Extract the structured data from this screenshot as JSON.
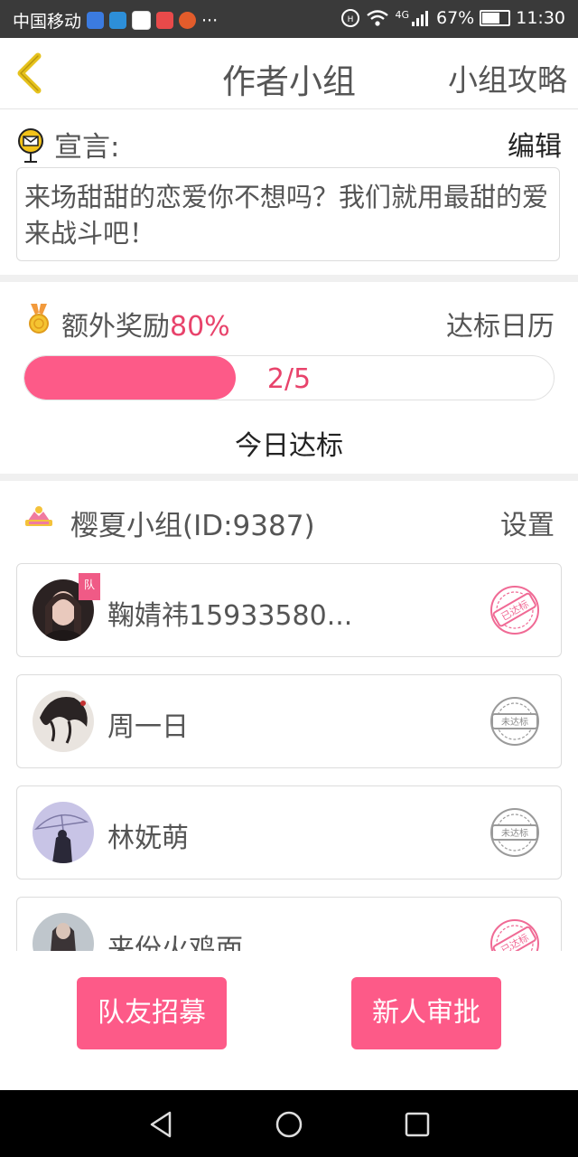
{
  "status_bar": {
    "carrier": "中国移动",
    "extra": "···",
    "network": "4G",
    "battery": "67%",
    "battery_level": 0.67,
    "time": "11:30"
  },
  "header": {
    "title": "作者小组",
    "right_link": "小组攻略"
  },
  "declaration": {
    "label": "宣言:",
    "edit": "编辑",
    "text": "来场甜甜的恋爱你不想吗？我们就用最甜的爱来战斗吧！"
  },
  "bonus": {
    "label": "额外奖励",
    "percent": "80%",
    "calendar": "达标日历",
    "progress_text": "2/5",
    "progress_done": 2,
    "progress_total": 5,
    "today": "今日达标"
  },
  "group": {
    "title": "樱夏小组(ID:9387)",
    "settings": "设置",
    "leader_badge": "队",
    "members": [
      {
        "name": "鞠婧祎15933580...",
        "leader": true,
        "stamp": "已达标",
        "status": "met"
      },
      {
        "name": "周一日",
        "leader": false,
        "stamp": "未达标",
        "status": "unmet"
      },
      {
        "name": "林妩萌",
        "leader": false,
        "stamp": "未达标",
        "status": "unmet"
      },
      {
        "name": "来份火鸡面",
        "leader": false,
        "stamp": "已达标",
        "status": "met"
      }
    ]
  },
  "buttons": {
    "recruit": "队友招募",
    "approve": "新人审批"
  },
  "colors": {
    "accent": "#fd5a88",
    "accent_text": "#e8436b",
    "back_arrow": "#e6c21d"
  }
}
